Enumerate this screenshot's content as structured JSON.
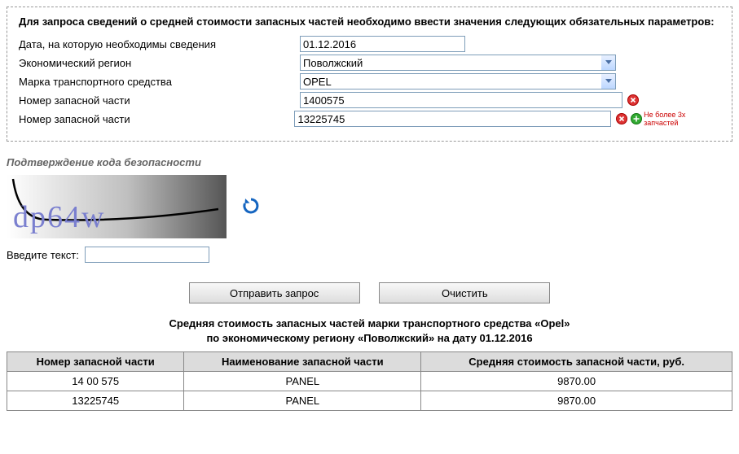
{
  "form": {
    "header": "Для запроса сведений о средней стоимости запасных частей необходимо ввести значения следующих обязательных параметров:",
    "labels": {
      "date": "Дата, на которую необходимы сведения",
      "region": "Экономический регион",
      "brand": "Марка транспортного средства",
      "part1": "Номер запасной части",
      "part2": "Номер запасной части"
    },
    "values": {
      "date": "01.12.2016",
      "region": "Поволжский",
      "brand": "OPEL",
      "part1": "1400575",
      "part2": "13225745"
    },
    "add_hint": "Не более 3х запчастей"
  },
  "captcha": {
    "title": "Подтверждение кода безопасности",
    "enter_label": "Введите текст:",
    "image_text": "dp64w"
  },
  "buttons": {
    "submit": "Отправить запрос",
    "clear": "Очистить"
  },
  "results": {
    "title_line1": "Средняя стоимость запасных частей марки транспортного средства «Opel»",
    "title_line2": "по экономическому региону «Поволжский» на дату 01.12.2016",
    "headers": {
      "num": "Номер запасной части",
      "name": "Наименование запасной части",
      "price": "Средняя стоимость запасной части, руб."
    },
    "rows": [
      {
        "num": "14 00 575",
        "name": "PANEL",
        "price": "9870.00"
      },
      {
        "num": "13225745",
        "name": "PANEL",
        "price": "9870.00"
      }
    ]
  }
}
